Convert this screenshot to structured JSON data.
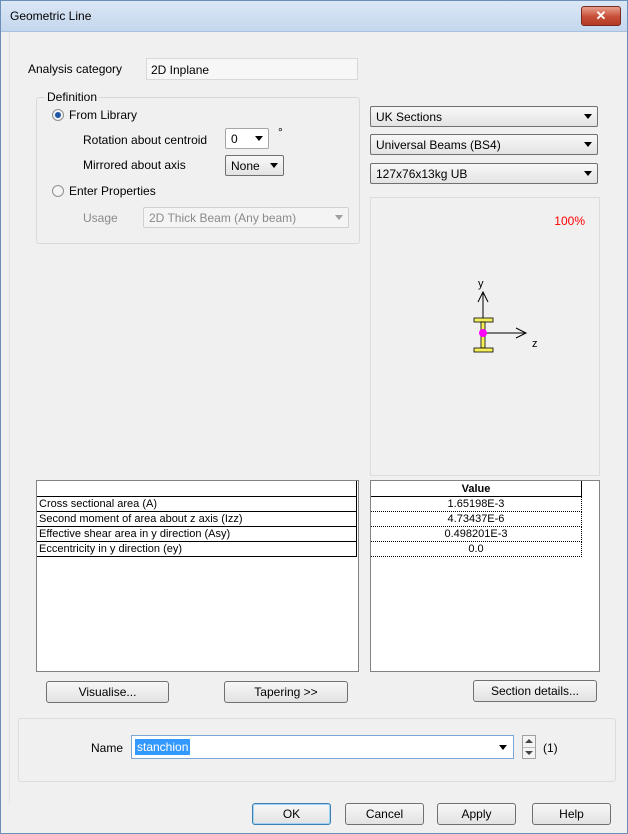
{
  "window": {
    "title": "Geometric Line",
    "close_glyph": "✕"
  },
  "analysis": {
    "label": "Analysis category",
    "value": "2D Inplane"
  },
  "definition": {
    "title": "Definition",
    "from_library_label": "From Library",
    "rotation_label": "Rotation about centroid",
    "rotation_value": "0",
    "rotation_unit": "°",
    "mirrored_label": "Mirrored about axis",
    "mirrored_value": "None",
    "enter_properties_label": "Enter Properties",
    "usage_label": "Usage",
    "usage_value": "2D Thick Beam (Any beam)",
    "selected": "from_library"
  },
  "library": {
    "source": "UK Sections",
    "family": "Universal Beams (BS4)",
    "section": "127x76x13kg UB"
  },
  "preview": {
    "zoom": "100%",
    "y_axis": "y",
    "z_axis": "z",
    "colors": {
      "flange": "#f5ef5a",
      "centroid": "#ff00ff",
      "zoom": "#ff0000"
    }
  },
  "properties": {
    "rows": [
      "Cross sectional area (A)",
      "Second moment of area about z axis (Izz)",
      "Effective shear area in y direction (Asy)",
      "Eccentricity in y direction (ey)"
    ],
    "value_header": "Value",
    "values": [
      "1.65198E-3",
      "4.73437E-6",
      "0.498201E-3",
      "0.0"
    ]
  },
  "buttons": {
    "visualise": "Visualise...",
    "tapering": "Tapering >>",
    "section_details": "Section details...",
    "ok": "OK",
    "cancel": "Cancel",
    "apply": "Apply",
    "help": "Help"
  },
  "name": {
    "label": "Name",
    "value": "stanchion",
    "count": "(1)"
  }
}
